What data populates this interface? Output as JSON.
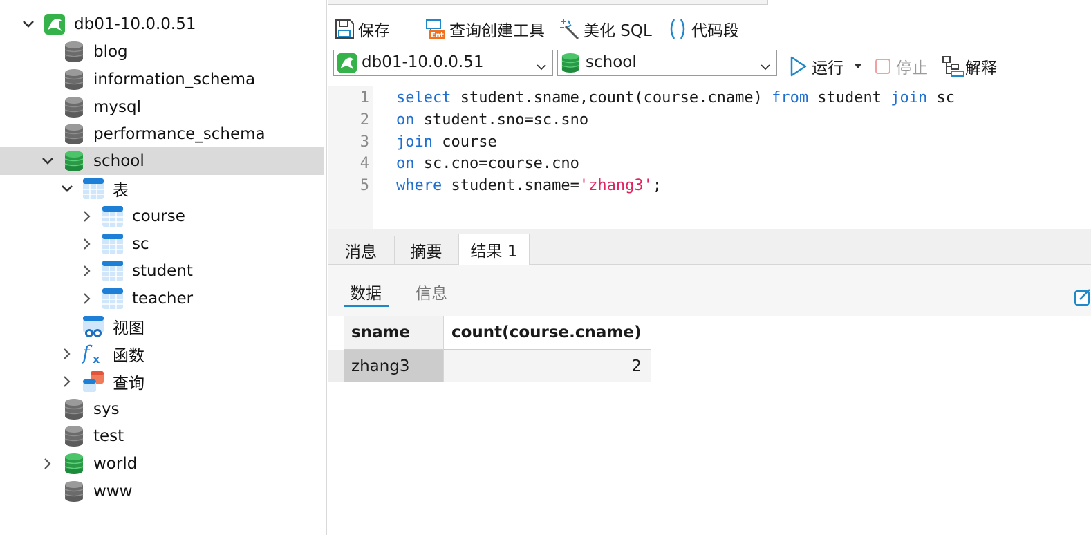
{
  "tree": {
    "connection": "db01-10.0.0.51",
    "items": [
      {
        "label": "blog"
      },
      {
        "label": "information_schema"
      },
      {
        "label": "mysql"
      },
      {
        "label": "performance_schema"
      },
      {
        "label": "school"
      },
      {
        "label": "表"
      },
      {
        "label": "course"
      },
      {
        "label": "sc"
      },
      {
        "label": "student"
      },
      {
        "label": "teacher"
      },
      {
        "label": "视图"
      },
      {
        "label": "函数"
      },
      {
        "label": "查询"
      },
      {
        "label": "sys"
      },
      {
        "label": "test"
      },
      {
        "label": "world"
      },
      {
        "label": "www"
      }
    ],
    "selected": "school"
  },
  "toolbar": {
    "save": "保存",
    "query_builder": "查询创建工具",
    "beautify": "美化 SQL",
    "snippet": "代码段",
    "connection_value": "db01-10.0.0.51",
    "database_value": "school",
    "run": "运行",
    "stop": "停止",
    "explain": "解释"
  },
  "editor": {
    "line_numbers": [
      "1",
      "2",
      "3",
      "4",
      "5"
    ],
    "lines": [
      [
        {
          "t": "select",
          "k": true
        },
        {
          "t": " student.sname,count(course.cname) "
        },
        {
          "t": "from",
          "k": true
        },
        {
          "t": " student "
        },
        {
          "t": "join",
          "k": true
        },
        {
          "t": " sc"
        }
      ],
      [
        {
          "t": "on",
          "k": true
        },
        {
          "t": " student.sno=sc.sno"
        }
      ],
      [
        {
          "t": "join",
          "k": true
        },
        {
          "t": " course"
        }
      ],
      [
        {
          "t": "on",
          "k": true
        },
        {
          "t": " sc.cno=course.cno"
        }
      ],
      [
        {
          "t": "where",
          "k": true
        },
        {
          "t": " student.sname="
        },
        {
          "t": "'zhang3'",
          "s": true
        },
        {
          "t": ";"
        }
      ]
    ]
  },
  "tabs": {
    "messages": "消息",
    "summary": "摘要",
    "result": "结果 1"
  },
  "subtabs": {
    "data": "数据",
    "info": "信息"
  },
  "grid": {
    "columns": [
      "sname",
      "count(course.cname)"
    ],
    "rows": [
      [
        "zhang3",
        "2"
      ]
    ]
  },
  "colors": {
    "accent": "#1e88c8",
    "keyword": "#1f6fd1",
    "string": "#e0245e",
    "db_active": "#2e9e4e",
    "db_inactive": "#6b6b6b"
  }
}
